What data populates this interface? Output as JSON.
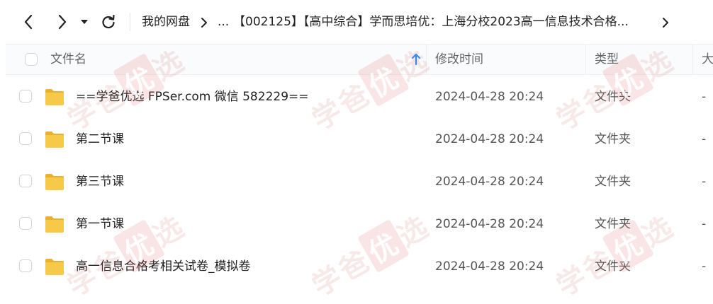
{
  "nav": {
    "breadcrumb_root": "我的网盘",
    "breadcrumb_ellipsis": "...",
    "breadcrumb_current": "【002125】【高中综合】学而思培优：上海分校2023高一信息技术合格..."
  },
  "header": {
    "name": "文件名",
    "modified": "修改时间",
    "type": "类型",
    "size": "大"
  },
  "rows": [
    {
      "name": "==学爸优选 FPSer.com 微信 582229==",
      "time": "2024-04-28 20:24",
      "type": "文件夹",
      "size": "-"
    },
    {
      "name": "第二节课",
      "time": "2024-04-28 20:24",
      "type": "文件夹",
      "size": "-"
    },
    {
      "name": "第三节课",
      "time": "2024-04-28 20:24",
      "type": "文件夹",
      "size": "-"
    },
    {
      "name": "第一节课",
      "time": "2024-04-28 20:24",
      "type": "文件夹",
      "size": "-"
    },
    {
      "name": "高一信息合格考相关试卷_模拟卷",
      "time": "2024-04-28 20:24",
      "type": "文件夹",
      "size": "-"
    }
  ],
  "watermark": {
    "text_a": "学爸",
    "text_b": "优",
    "text_c": "选"
  },
  "colors": {
    "folder": "#f7c948",
    "accent_sort": "#2d8cf0"
  }
}
